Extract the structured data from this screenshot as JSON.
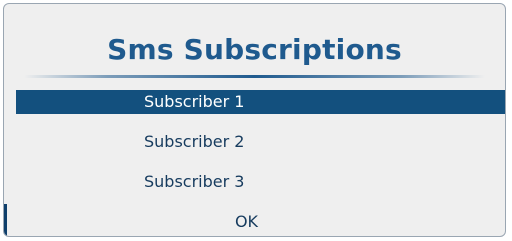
{
  "dialog": {
    "title": "Sms Subscriptions"
  },
  "menu": {
    "items": [
      {
        "label": "Subscriber 1",
        "selected": true
      },
      {
        "label": "Subscriber 2",
        "selected": false
      },
      {
        "label": "Subscriber 3",
        "selected": false
      }
    ],
    "ok_label": "OK"
  },
  "colors": {
    "title": "#1f5a8e",
    "selection_background": "#13507e",
    "dialog_background": "#efefef",
    "item_text": "#163b5e"
  }
}
